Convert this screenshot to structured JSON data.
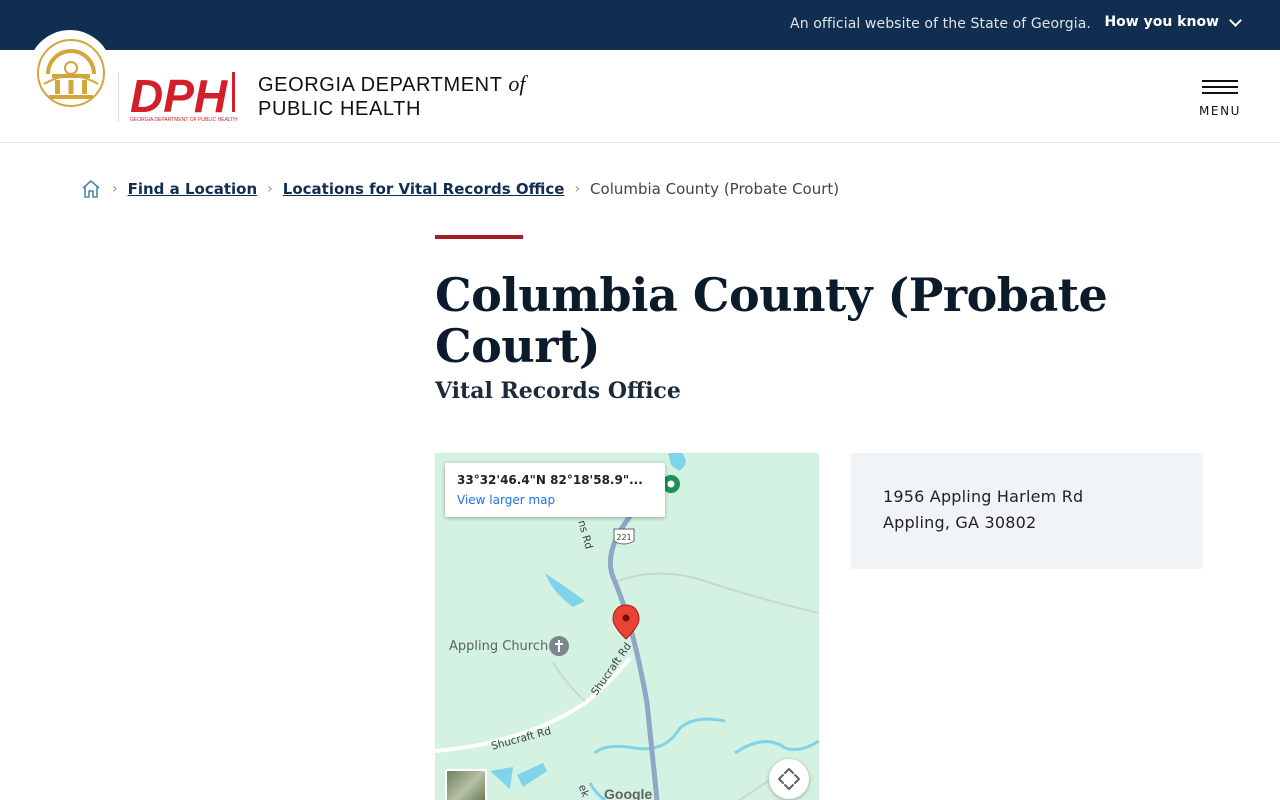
{
  "banner": {
    "official_text": "An official website of the State of Georgia.",
    "how_you_know": "How you know"
  },
  "header": {
    "agency_line1_a": "GEORGIA DEPARTMENT",
    "agency_of": "of",
    "agency_line2": "PUBLIC HEALTH",
    "dph_logo_text": "DPH",
    "dph_logo_caption": "GEORGIA DEPARTMENT OF PUBLIC HEALTH",
    "menu_label": "MENU"
  },
  "breadcrumb": {
    "home_icon": "home-icon",
    "items": [
      "Find a Location",
      "Locations for Vital Records Office"
    ],
    "current": "Columbia County (Probate Court)"
  },
  "page": {
    "title": "Columbia County (Probate Court)",
    "subtitle": "Vital Records Office"
  },
  "map": {
    "coords": "33°32'46.4\"N 82°18'58.9\"...",
    "view_larger": "View larger map",
    "place_label": "Appling Church",
    "road_shucraft_rd_1": "Shucraft Rd",
    "road_shucraft_rd_2": "Shucraft Rd",
    "road_ns_rd": "ns Rd",
    "route_shield": "221",
    "creek_fragment": "ek",
    "google": "Google",
    "colors": {
      "land": "#d4f2e2",
      "water": "#7fd3ea",
      "road": "#8fa6c6",
      "pin": "#ea4335"
    }
  },
  "address": {
    "line1": "1956 Appling Harlem Rd",
    "line2": "Appling, GA 30802"
  },
  "colors": {
    "banner_bg": "#112e51",
    "accent_red": "#a51c22",
    "dph_red": "#d31f2a",
    "seal_gold": "#d3a53a"
  }
}
